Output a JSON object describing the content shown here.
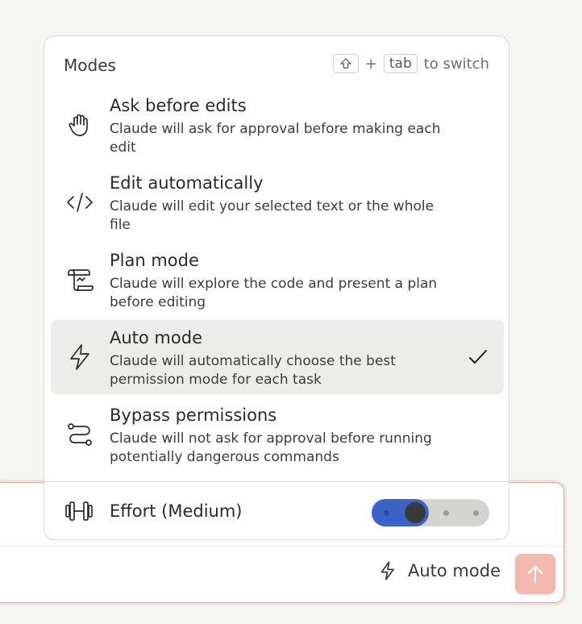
{
  "composer": {
    "mode_label": "Auto mode"
  },
  "popover": {
    "title": "Modes",
    "shortcut": {
      "key": "tab",
      "plus": "+",
      "suffix": "to switch"
    },
    "modes": [
      {
        "name": "Ask before edits",
        "desc": "Claude will ask for approval before making each edit",
        "icon": "hand-icon",
        "selected": false
      },
      {
        "name": "Edit automatically",
        "desc": "Claude will edit your selected text or the whole file",
        "icon": "code-icon",
        "selected": false
      },
      {
        "name": "Plan mode",
        "desc": "Claude will explore the code and present a plan before editing",
        "icon": "scroll-icon",
        "selected": false
      },
      {
        "name": "Auto mode",
        "desc": "Claude will automatically choose the best permission mode for each task",
        "icon": "bolt-icon",
        "selected": true
      },
      {
        "name": "Bypass permissions",
        "desc": "Claude will not ask for approval before running potentially dangerous commands",
        "icon": "route-icon",
        "selected": false
      }
    ],
    "effort": {
      "label": "Effort (Medium)",
      "level": 2,
      "levels": 4
    }
  },
  "colors": {
    "accent": "#3a64c8",
    "send_button": "#f3b9ae",
    "selected_bg": "#ececea"
  }
}
